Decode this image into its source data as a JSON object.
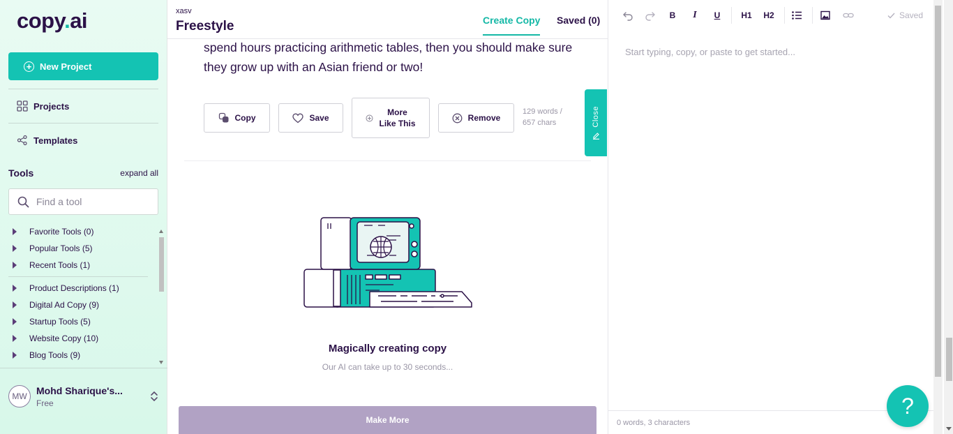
{
  "sidebar": {
    "logo_main": "copy",
    "logo_dot": ".",
    "logo_ai": "ai",
    "new_project_label": "New Project",
    "projects_label": "Projects",
    "templates_label": "Templates",
    "tools_title": "Tools",
    "expand_all_label": "expand all",
    "search_placeholder": "Find a tool",
    "tool_groups": [
      "Favorite Tools (0)",
      "Popular Tools (5)",
      "Recent Tools (1)",
      "Product Descriptions (1)",
      "Digital Ad Copy (9)",
      "Startup Tools (5)",
      "Website Copy (10)",
      "Blog Tools (9)"
    ],
    "user": {
      "initials": "MW",
      "name": "Mohd Sharique's...",
      "plan": "Free"
    }
  },
  "header": {
    "project_subtitle": "xasv",
    "project_title": "Freestyle",
    "tab_create": "Create Copy",
    "tab_saved": "Saved (0)"
  },
  "output": {
    "text": "spend hours practicing arithmetic tables, then you should make sure they grow up with an Asian friend or two!",
    "copy_label": "Copy",
    "save_label": "Save",
    "more_label_1": "More",
    "more_label_2": "Like This",
    "remove_label": "Remove",
    "count_words": "129 words /",
    "count_chars": "657 chars",
    "close_label": "Close"
  },
  "loading": {
    "title": "Magically creating copy",
    "subtitle": "Our AI can take up to 30 seconds..."
  },
  "make_more_label": "Make More",
  "editor": {
    "toolbar": [
      "B",
      "I",
      "U",
      "H1",
      "H2"
    ],
    "saved_label": "Saved",
    "placeholder": "Start typing, copy, or paste to get started...",
    "footer": "0 words, 3 characters"
  },
  "help_label": "?",
  "colors": {
    "brand_teal": "#14c3b3",
    "brand_purple": "#2b1147",
    "make_more_disabled": "#b1a2c4"
  }
}
